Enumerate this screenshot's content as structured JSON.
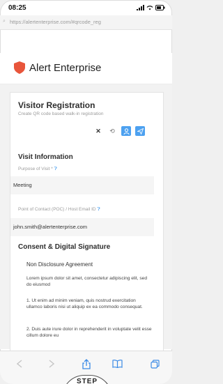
{
  "status": {
    "time": "08:25"
  },
  "browser": {
    "url": "https://alertenterprise.com/#qrcode_reg"
  },
  "brand": {
    "name": "Alert Enterprise",
    "logo_color": "#e8553b"
  },
  "page": {
    "title": "Visitor Registration",
    "subtitle": "Create QR code based walk-in registration"
  },
  "toolbar": {
    "close": "✕",
    "refresh": "⟲"
  },
  "visit": {
    "heading": "Visit Information",
    "purpose_label": "Purpose of Visit *",
    "purpose_value": "Meeting",
    "poc_label": "Point of Contact (POC) / Host Email ID",
    "poc_value": "john.smith@alertenterprise.com"
  },
  "consent": {
    "heading": "Consent & Digital Signature",
    "nda_title": "Non Disclosure Agreement",
    "paragraphs": [
      "Lorem ipsum dolor sit amet, consectetur adipiscing elit, sed do eiusmod",
      "1. Ut enim ad minim veniam, quis nostrud exercitation ullamco laboris nisi ut aliquip ex ea commodo consequat.",
      "2. Duis aute irure dolor in reprehenderit in voluptate velit esse cillum dolore eu"
    ]
  },
  "step": {
    "label": "STEP"
  },
  "colors": {
    "accent": "#4da1f0",
    "brand": "#e8553b"
  }
}
